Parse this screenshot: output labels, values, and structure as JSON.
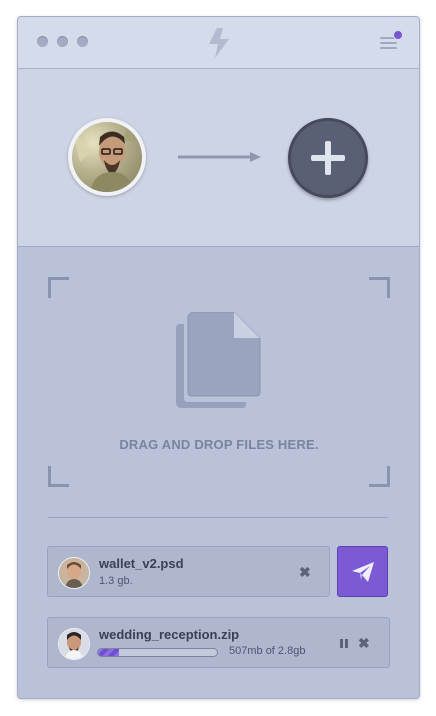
{
  "titlebar": {
    "window_controls": [
      "close-dot-icon",
      "minimize-dot-icon",
      "zoom-dot-icon"
    ],
    "logo_icon": "lightning-bolt-icon",
    "menu_icon": "hamburger-menu-icon",
    "has_notification": true
  },
  "transfer": {
    "recipient_avatar": "user-avatar-icon",
    "arrow_icon": "right-arrow-icon",
    "add_button_icon": "plus-icon"
  },
  "dropzone": {
    "icon": "documents-icon",
    "label": "DRAG AND DROP FILES HERE."
  },
  "files": [
    {
      "name": "wallet_v2.psd",
      "size": "1.3 gb.",
      "remove_icon": "close-icon"
    },
    {
      "name": "wedding_reception.zip",
      "progress_text": "507mb of 2.8gb",
      "progress": 0.18,
      "pause_icon": "pause-icon",
      "remove_icon": "close-icon"
    }
  ],
  "send_button": {
    "icon": "paper-plane-icon"
  },
  "colors": {
    "accent": "#7b5ad3",
    "background": "#b9c2d8",
    "titlebar": "#d4dbea",
    "header": "#cdd4e5",
    "text_dark": "#3a4055",
    "notification": "#7657d0"
  },
  "symbols": {
    "remove": "✖"
  }
}
